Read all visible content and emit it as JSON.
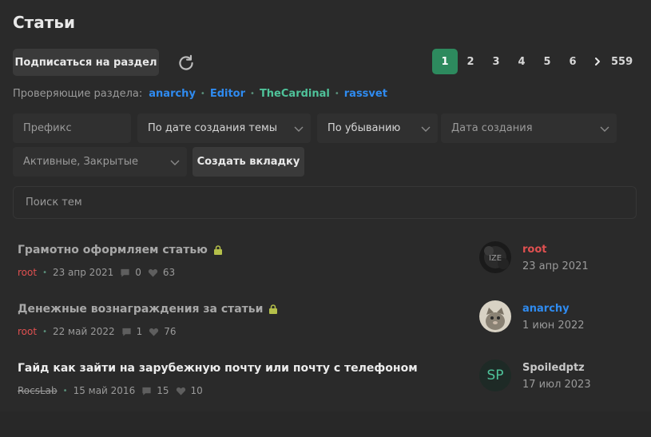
{
  "page": {
    "title": "Статьи"
  },
  "toolbar": {
    "subscribe_label": "Подписаться на раздел",
    "refresh_icon": "refresh-icon"
  },
  "pagination": {
    "pages": [
      "1",
      "2",
      "3",
      "4",
      "5",
      "6"
    ],
    "current": "1",
    "last": "559",
    "next_icon": "chevron-right-icon"
  },
  "moderators": {
    "label": "Проверяющие раздела:",
    "users": [
      {
        "name": "anarchy",
        "color": "#2f8bf0"
      },
      {
        "name": "Editor",
        "color": "#2f8bf0"
      },
      {
        "name": "TheCardinal",
        "color": "#4fc39a"
      },
      {
        "name": "rassvet",
        "color": "#2f8bf0"
      }
    ]
  },
  "filters": {
    "prefix_placeholder": "Префикс",
    "sort_by": "По дате создания темы",
    "order": "По убыванию",
    "date_placeholder": "Дата создания",
    "state": "Активные, Закрытые",
    "create_tab_label": "Создать вкладку"
  },
  "search": {
    "placeholder": "Поиск тем"
  },
  "threads": [
    {
      "title": "Грамотно оформляем статью",
      "locked": true,
      "author": "root",
      "date": "23 апр 2021",
      "replies": "0",
      "likes": "63",
      "last_user": "root",
      "last_user_color": "#e05050",
      "last_date": "23 апр 2021"
    },
    {
      "title": "Денежные вознаграждения за статьи",
      "locked": true,
      "author": "root",
      "date": "22 май 2022",
      "replies": "1",
      "likes": "76",
      "last_user": "anarchy",
      "last_user_color": "#2f8bf0",
      "last_date": "1 июн 2022"
    },
    {
      "title": "Гайд как зайти на зарубежную почту или почту с телефоном",
      "locked": false,
      "author": "RocsLab",
      "date": "15 май 2016",
      "replies": "15",
      "likes": "10",
      "last_user": "Spoiledptz",
      "last_user_color": "#c8c8c8",
      "last_date": "17 июл 2023",
      "last_avatar_initials": "SP"
    }
  ],
  "colors": {
    "accent": "#2d8a5e",
    "lock": "#b5c04a"
  }
}
